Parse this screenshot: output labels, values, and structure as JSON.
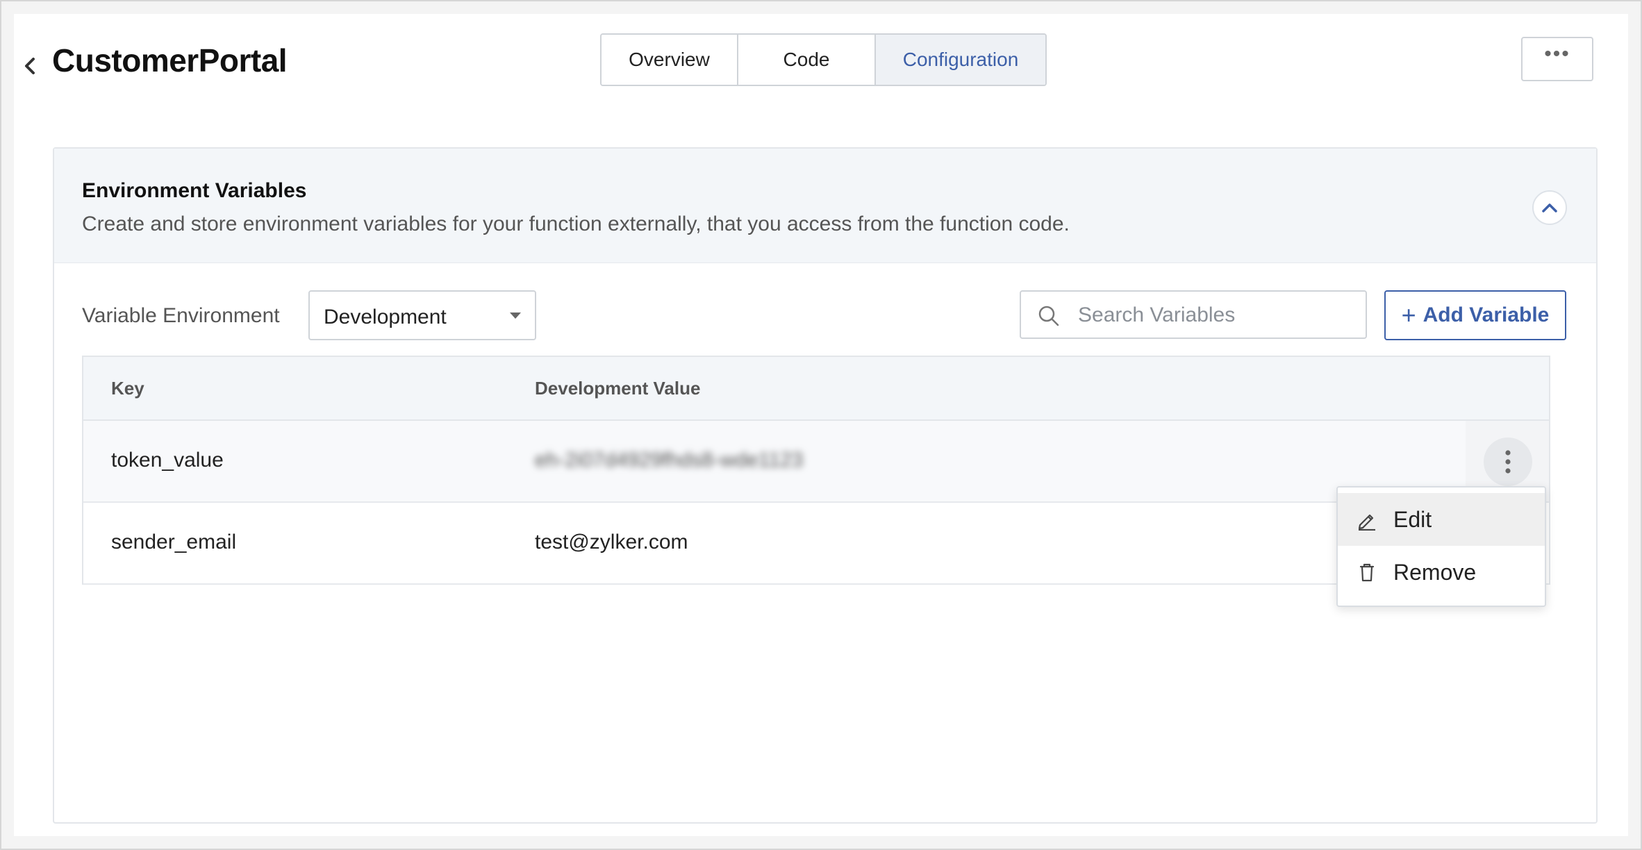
{
  "header": {
    "title": "CustomerPortal",
    "tabs": [
      {
        "label": "Overview",
        "active": false
      },
      {
        "label": "Code",
        "active": false
      },
      {
        "label": "Configuration",
        "active": true
      }
    ],
    "more_label": "•••"
  },
  "env_section": {
    "title": "Environment Variables",
    "description": "Create and store environment variables for your function externally, that you access from the function code.",
    "variable_environment_label": "Variable Environment",
    "selected_environment": "Development",
    "search_placeholder": "Search Variables",
    "add_button_label": "Add Variable",
    "add_button_plus": "+"
  },
  "table": {
    "columns": [
      "Key",
      "Development Value"
    ],
    "rows": [
      {
        "key": "token_value",
        "value": "eh-2i07d4929fhds8-wde1123",
        "masked": true
      },
      {
        "key": "sender_email",
        "value": "test@zylker.com",
        "masked": false
      }
    ]
  },
  "context_menu": {
    "items": [
      {
        "label": "Edit",
        "icon": "pencil-icon"
      },
      {
        "label": "Remove",
        "icon": "trash-icon"
      }
    ]
  },
  "colors": {
    "accent": "#3c5fa8",
    "panel_header_bg": "#f3f6f9",
    "border": "#cfd3d8"
  }
}
